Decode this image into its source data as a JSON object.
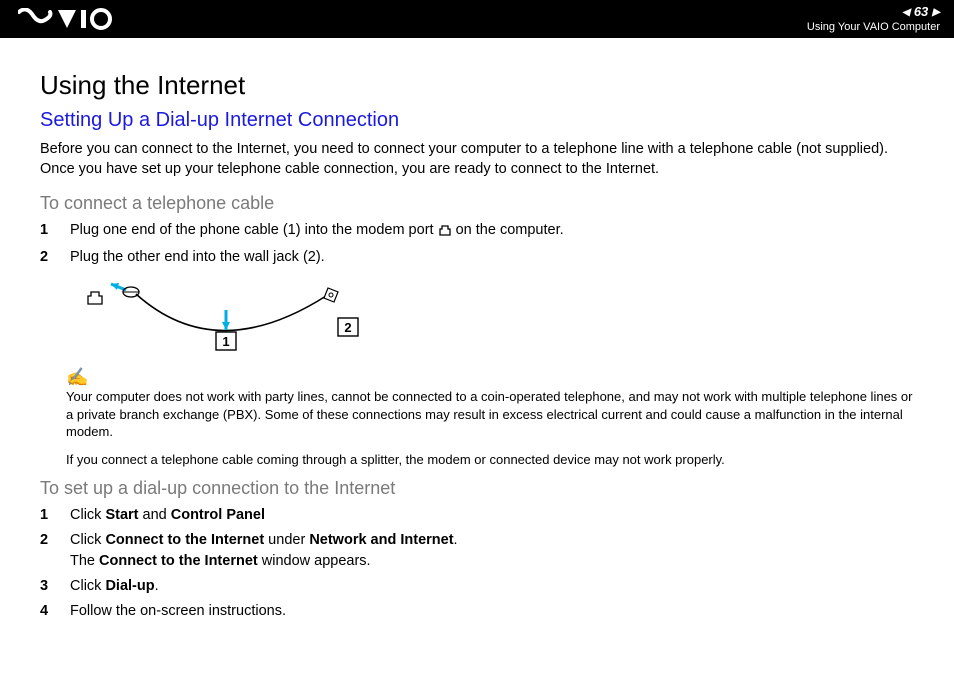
{
  "header": {
    "page_number": "63",
    "breadcrumb": "Using Your VAIO Computer"
  },
  "body": {
    "title": "Using the Internet",
    "subtitle": "Setting Up a Dial-up Internet Connection",
    "intro": "Before you can connect to the Internet, you need to connect your computer to a telephone line with a telephone cable (not supplied). Once you have set up your telephone cable connection, you are ready to connect to the Internet.",
    "task1_heading": "To connect a telephone cable",
    "task1_steps": {
      "s1a": "Plug one end of the phone cable (1) into the modem port ",
      "s1b": " on the computer.",
      "s2": "Plug the other end into the wall jack (2)."
    },
    "diagram_labels": {
      "label1": "1",
      "label2": "2"
    },
    "note1": "Your computer does not work with party lines, cannot be connected to a coin-operated telephone, and may not work with multiple telephone lines or a private branch exchange (PBX). Some of these connections may result in excess electrical current and could cause a malfunction in the internal modem.",
    "note2": "If you connect a telephone cable coming through a splitter, the modem or connected device may not work properly.",
    "task2_heading": "To set up a dial-up connection to the Internet",
    "task2_steps": {
      "s1_pre": "Click ",
      "s1_b1": "Start",
      "s1_mid": " and ",
      "s1_b2": "Control Panel",
      "s2_pre": "Click ",
      "s2_b1": "Connect to the Internet",
      "s2_mid": " under ",
      "s2_b2": "Network and Internet",
      "s2_end": ".",
      "s2b_pre": "The ",
      "s2b_b1": "Connect to the Internet",
      "s2b_end": " window appears.",
      "s3_pre": "Click ",
      "s3_b1": "Dial-up",
      "s3_end": ".",
      "s4": "Follow the on-screen instructions."
    }
  }
}
